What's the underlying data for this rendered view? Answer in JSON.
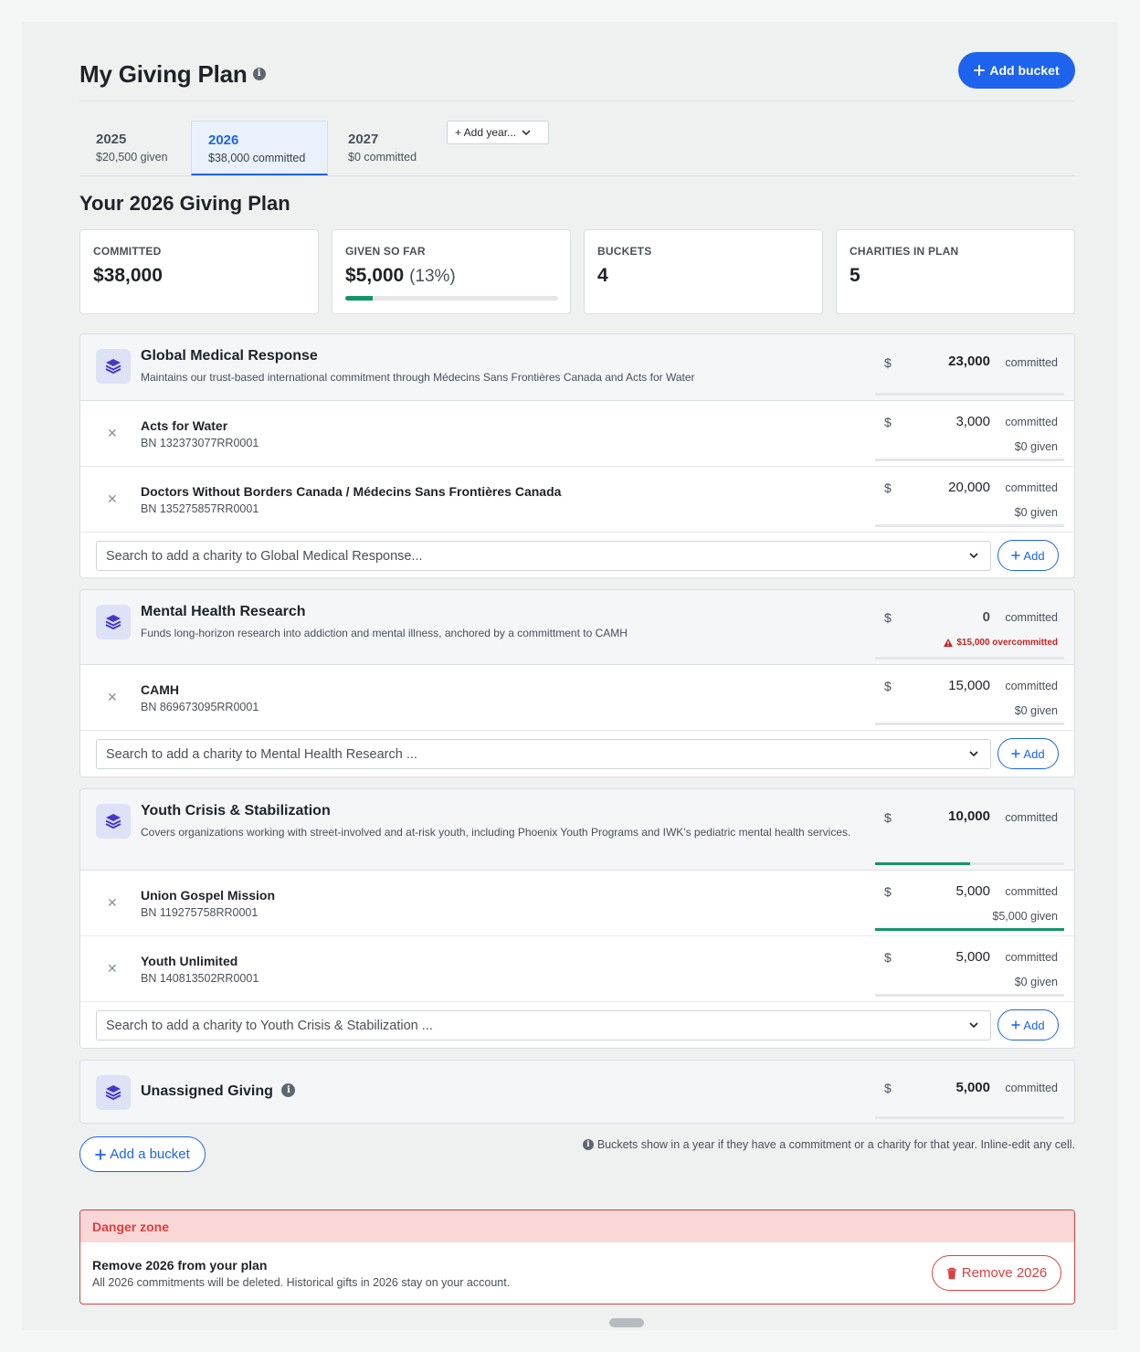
{
  "header": {
    "title": "My Giving Plan",
    "add_bucket_label": "Add bucket"
  },
  "tabs": [
    {
      "year": "2025",
      "sub": "$20,500 given"
    },
    {
      "year": "2026",
      "sub": "$38,000 committed"
    },
    {
      "year": "2027",
      "sub": "$0 committed"
    }
  ],
  "add_year_label": "+ Add year...",
  "subtitle": "Your 2026 Giving Plan",
  "stats": {
    "committed": {
      "label": "COMMITTED",
      "value": "$38,000"
    },
    "given": {
      "label": "GIVEN SO FAR",
      "value": "$5,000",
      "pct": "(13%)",
      "progress": 0.13
    },
    "buckets": {
      "label": "BUCKETS",
      "value": "4"
    },
    "charities": {
      "label": "CHARITIES IN PLAN",
      "value": "5"
    }
  },
  "currency": "$",
  "committed_word": "committed",
  "buckets": [
    {
      "name": "Global Medical Response",
      "desc": "Maintains our trust-based international commitment through Médecins Sans Frontières Canada and Acts for Water",
      "amount": "23,000",
      "progress": 0,
      "charities": [
        {
          "name": "Acts for Water",
          "bn": "BN 132373077RR0001",
          "amount": "3,000",
          "given": "$0 given",
          "progress": 0
        },
        {
          "name": "Doctors Without Borders Canada / Médecins Sans Frontières Canada",
          "bn": "BN 135275857RR0001",
          "amount": "20,000",
          "given": "$0 given",
          "progress": 0
        }
      ],
      "search_placeholder": "Search to add a charity to Global Medical Response...",
      "add_label": "Add"
    },
    {
      "name": "Mental Health Research",
      "desc": "Funds long-horizon research into addiction and mental illness, anchored by a committment to CAMH",
      "amount": "0",
      "warning": "$15,000 overcommitted",
      "progress": 0,
      "charities": [
        {
          "name": "CAMH",
          "bn": "BN 869673095RR0001",
          "amount": "15,000",
          "given": "$0 given",
          "progress": 0
        }
      ],
      "search_placeholder": "Search to add a charity to Mental Health Research ...",
      "add_label": "Add"
    },
    {
      "name": "Youth Crisis & Stabilization",
      "desc": "Covers organizations working with street-involved and at-risk youth, including Phoenix Youth Programs and IWK's pediatric mental health services.",
      "amount": "10,000",
      "progress": 0.5,
      "charities": [
        {
          "name": "Union Gospel Mission",
          "bn": "BN 119275758RR0001",
          "amount": "5,000",
          "given": "$5,000 given",
          "progress": 1
        },
        {
          "name": "Youth Unlimited",
          "bn": "BN 140813502RR0001",
          "amount": "5,000",
          "given": "$0 given",
          "progress": 0
        }
      ],
      "search_placeholder": "Search to add a charity to Youth Crisis & Stabilization ...",
      "add_label": "Add"
    },
    {
      "name": "Unassigned Giving",
      "amount": "5,000",
      "progress": 0
    }
  ],
  "add_bucket_bottom_label": "Add a bucket",
  "footnote": "Buckets show in a year if they have a commitment or a charity for that year. Inline-edit any cell.",
  "danger": {
    "heading": "Danger zone",
    "title": "Remove 2026 from your plan",
    "desc": "All 2026 commitments will be deleted. Historical gifts in 2026 stay on your account.",
    "button": "Remove 2026"
  },
  "colors": {
    "accent": "#1d63ed",
    "success": "#13946b",
    "danger": "#d94141"
  },
  "icons": [
    "info-icon",
    "plus-icon",
    "chevron-down-icon",
    "layers-icon",
    "close-icon",
    "warning-icon",
    "trash-icon"
  ]
}
